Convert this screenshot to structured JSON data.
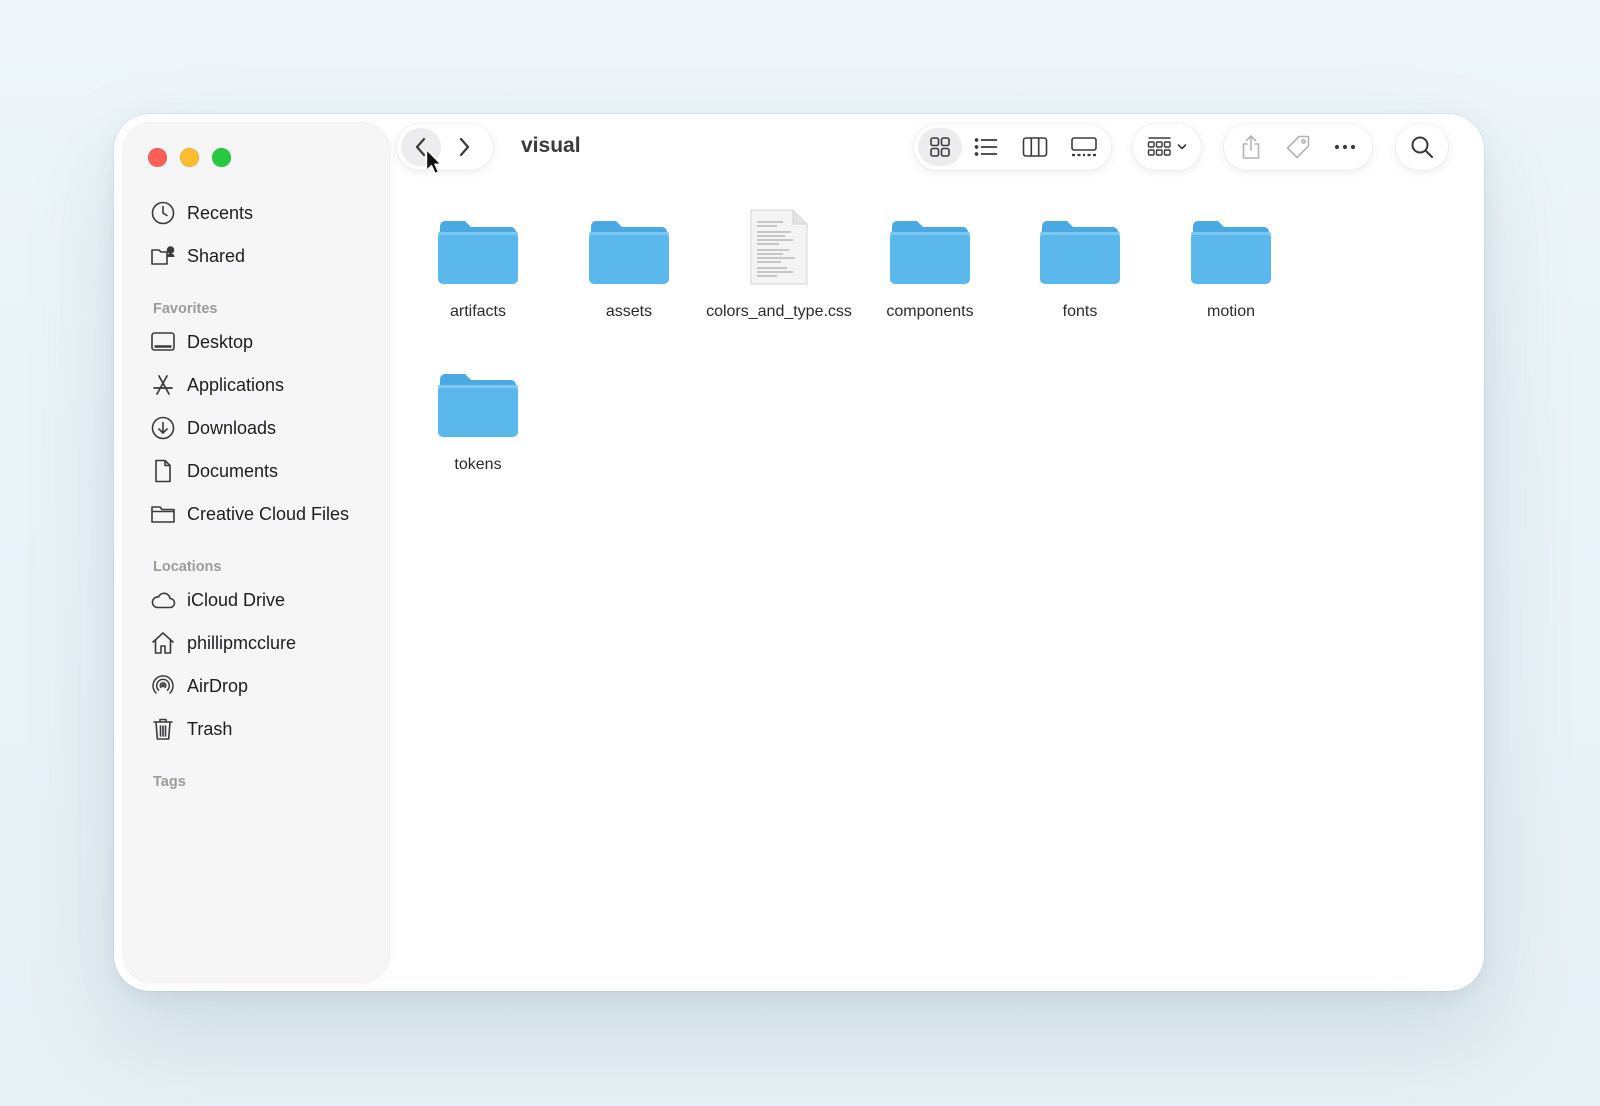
{
  "window": {
    "title": "visual"
  },
  "sidebar": {
    "top_items": [
      {
        "label": "Recents",
        "icon": "clock-icon"
      },
      {
        "label": "Shared",
        "icon": "shared-folder-icon"
      }
    ],
    "favorites_label": "Favorites",
    "favorites": [
      {
        "label": "Desktop",
        "icon": "desktop-icon"
      },
      {
        "label": "Applications",
        "icon": "applications-icon"
      },
      {
        "label": "Downloads",
        "icon": "download-icon"
      },
      {
        "label": "Documents",
        "icon": "document-icon"
      },
      {
        "label": "Creative Cloud Files",
        "icon": "folder-icon"
      }
    ],
    "locations_label": "Locations",
    "locations": [
      {
        "label": "iCloud Drive",
        "icon": "cloud-icon"
      },
      {
        "label": "phillipmcclure",
        "icon": "home-icon"
      },
      {
        "label": "AirDrop",
        "icon": "airdrop-icon"
      },
      {
        "label": "Trash",
        "icon": "trash-icon"
      }
    ],
    "tags_label": "Tags"
  },
  "toolbar": {
    "view_mode": "icons",
    "buttons": [
      "back",
      "forward",
      "icon-view",
      "list-view",
      "column-view",
      "gallery-view",
      "group",
      "share",
      "tag",
      "more",
      "search"
    ]
  },
  "files": [
    {
      "name": "artifacts",
      "kind": "folder"
    },
    {
      "name": "assets",
      "kind": "folder"
    },
    {
      "name": "colors_and_type.css",
      "kind": "document"
    },
    {
      "name": "components",
      "kind": "folder"
    },
    {
      "name": "fonts",
      "kind": "folder"
    },
    {
      "name": "motion",
      "kind": "folder"
    },
    {
      "name": "tokens",
      "kind": "folder"
    }
  ],
  "colors": {
    "folder": "#5bb8ec",
    "close": "#ff5f57",
    "minimize": "#febc2e",
    "zoom": "#28c840"
  }
}
